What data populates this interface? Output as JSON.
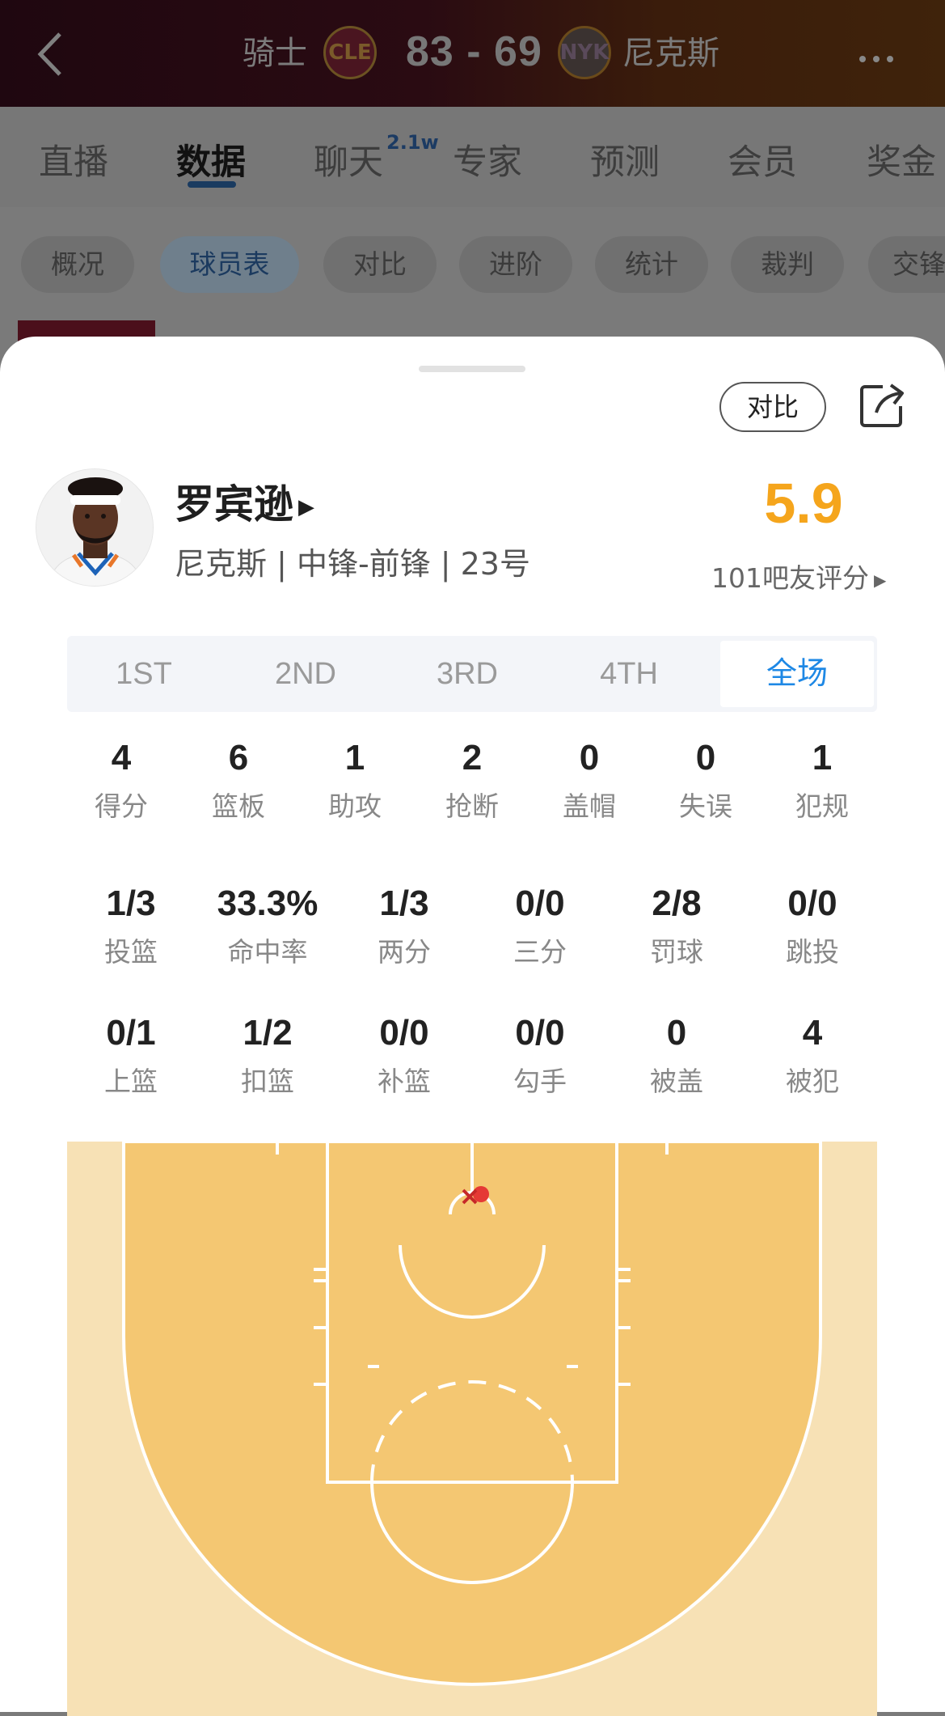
{
  "header": {
    "home_team": "骑士",
    "home_logo": "CLE",
    "score": "83 - 69",
    "away_logo": "NYK",
    "away_team": "尼克斯",
    "back_icon": "chevron-left-icon",
    "more_icon": "more-dots-icon"
  },
  "main_tabs": {
    "items": [
      "直播",
      "数据",
      "聊天",
      "专家",
      "预测",
      "会员",
      "奖金"
    ],
    "active": "数据",
    "chat_badge": "2.1w"
  },
  "sub_tabs": {
    "items": [
      "概况",
      "球员表",
      "对比",
      "进阶",
      "统计",
      "裁判",
      "交锋"
    ],
    "active": "球员表"
  },
  "sheet": {
    "compare_button": "对比",
    "share_icon": "share-icon",
    "player": {
      "name": "罗宾逊",
      "meta": "尼克斯 | 中锋-前锋 | 23号",
      "rating": "5.9",
      "rating_label": "101吧友评分"
    },
    "periods": [
      "1ST",
      "2ND",
      "3RD",
      "4TH",
      "全场"
    ],
    "active_period": "全场",
    "stats_row1": [
      {
        "value": "4",
        "label": "得分"
      },
      {
        "value": "6",
        "label": "篮板"
      },
      {
        "value": "1",
        "label": "助攻"
      },
      {
        "value": "2",
        "label": "抢断"
      },
      {
        "value": "0",
        "label": "盖帽"
      },
      {
        "value": "0",
        "label": "失误"
      },
      {
        "value": "1",
        "label": "犯规"
      }
    ],
    "stats_row2": [
      {
        "value": "1/3",
        "label": "投篮"
      },
      {
        "value": "33.3%",
        "label": "命中率"
      },
      {
        "value": "1/3",
        "label": "两分"
      },
      {
        "value": "0/0",
        "label": "三分"
      },
      {
        "value": "2/8",
        "label": "罚球"
      },
      {
        "value": "0/0",
        "label": "跳投"
      }
    ],
    "stats_row3": [
      {
        "value": "0/1",
        "label": "上篮"
      },
      {
        "value": "1/2",
        "label": "扣篮"
      },
      {
        "value": "0/0",
        "label": "补篮"
      },
      {
        "value": "0/0",
        "label": "勾手"
      },
      {
        "value": "0",
        "label": "被盖"
      },
      {
        "value": "4",
        "label": "被犯"
      }
    ],
    "shot_chart": {
      "made_shots": 1,
      "missed_shots": 1,
      "colors": {
        "court": "#f4c772",
        "outside": "#f7e1b5",
        "made": "#e53935",
        "missed": "#c62828"
      }
    }
  }
}
